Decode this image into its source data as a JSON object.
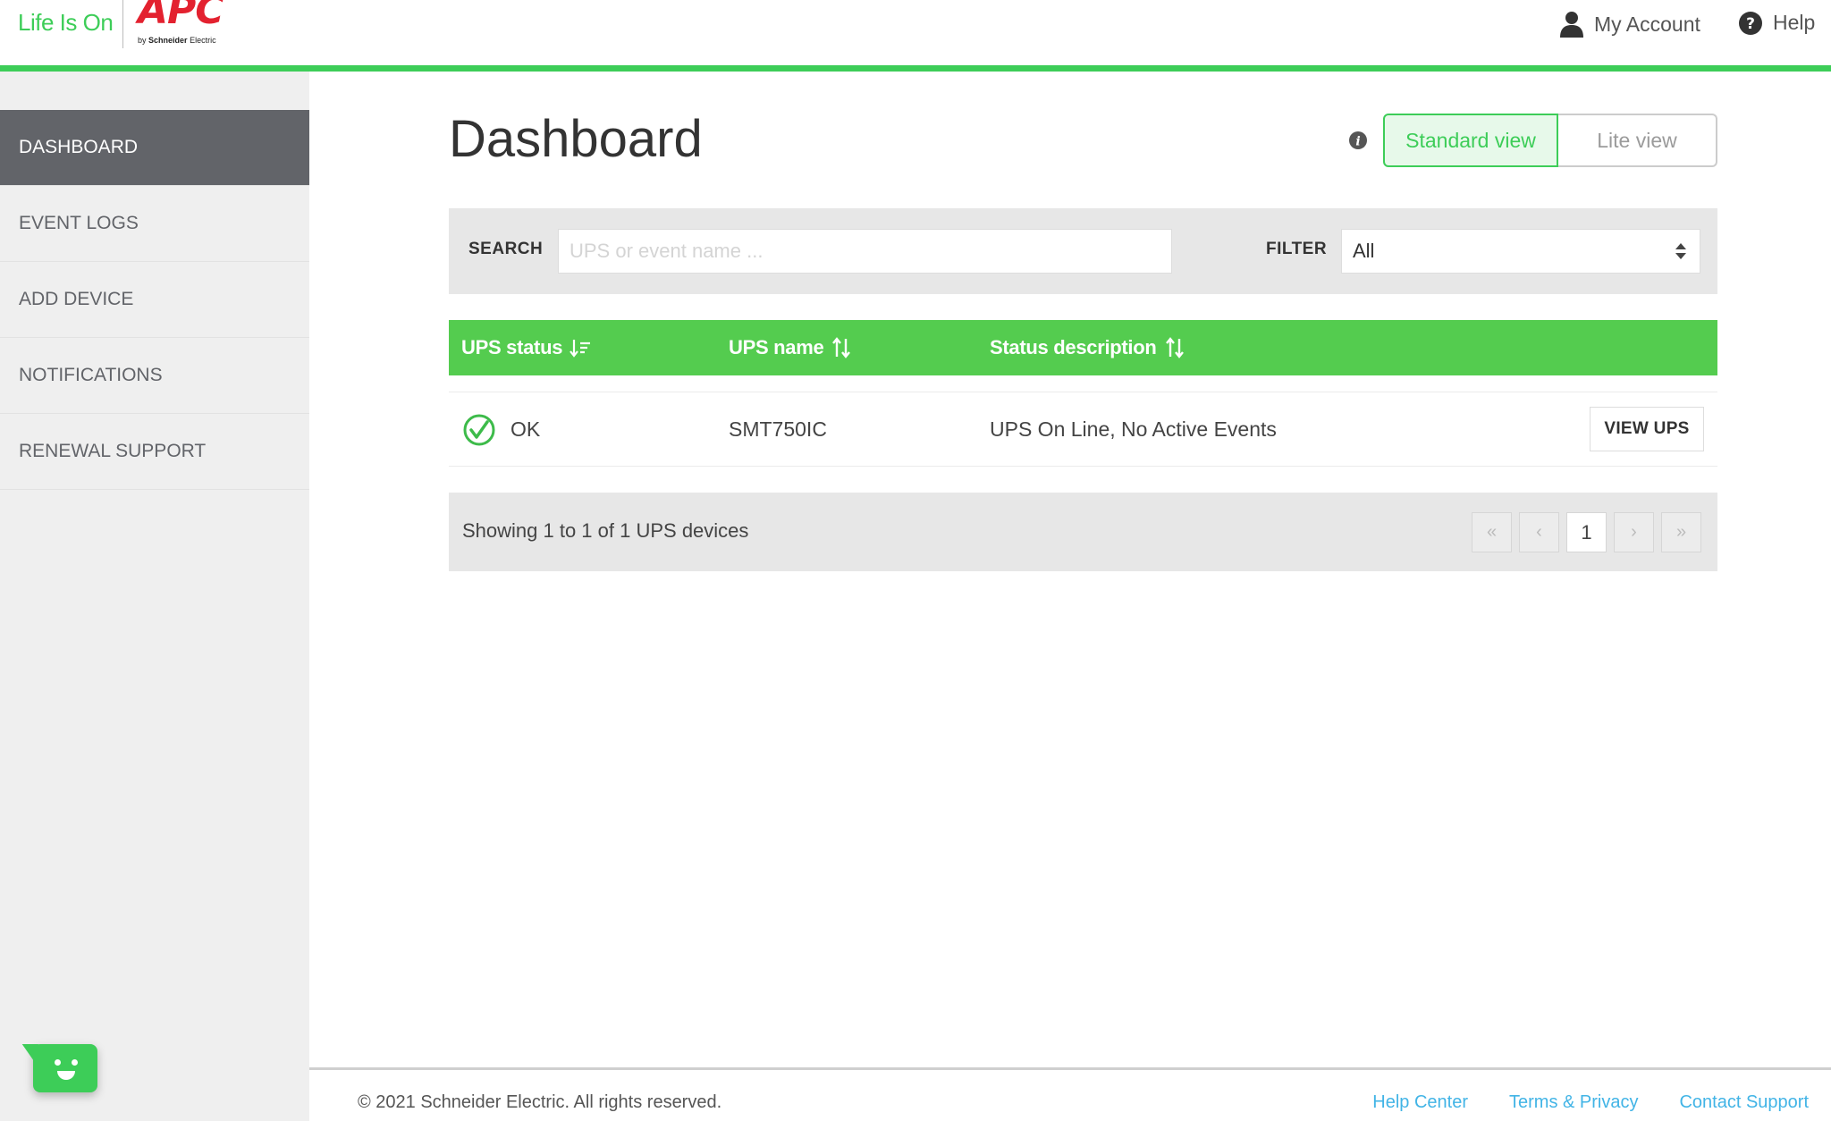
{
  "header": {
    "tagline": "Life Is On",
    "brand": "APC",
    "brand_sub_prefix": "by",
    "brand_sub_company": "Schneider",
    "brand_sub_suffix": "Electric",
    "my_account": "My Account",
    "help": "Help",
    "accent_color": "#3dcd58"
  },
  "sidebar": {
    "items": [
      {
        "label": "DASHBOARD",
        "active": true
      },
      {
        "label": "EVENT LOGS",
        "active": false
      },
      {
        "label": "ADD DEVICE",
        "active": false
      },
      {
        "label": "NOTIFICATIONS",
        "active": false
      },
      {
        "label": "RENEWAL SUPPORT",
        "active": false
      }
    ]
  },
  "main": {
    "title": "Dashboard",
    "views": {
      "standard": "Standard view",
      "lite": "Lite view",
      "selected": "standard"
    },
    "search": {
      "label": "SEARCH",
      "placeholder": "UPS or event name ...",
      "value": ""
    },
    "filter": {
      "label": "FILTER",
      "selected": "All"
    },
    "table": {
      "columns": [
        "UPS status",
        "UPS name",
        "Status description"
      ],
      "rows": [
        {
          "status": "OK",
          "name": "SMT750IC",
          "description": "UPS On Line, No Active Events",
          "action": "VIEW UPS"
        }
      ]
    },
    "pagination": {
      "summary": "Showing 1 to 1 of 1 UPS devices",
      "first": "«",
      "prev": "‹",
      "current_page": "1",
      "next": "›",
      "last": "»"
    }
  },
  "footer": {
    "copyright": "© 2021 Schneider Electric. All rights reserved.",
    "links": [
      "Help Center",
      "Terms & Privacy",
      "Contact Support"
    ]
  },
  "icons": {
    "account": "user-icon",
    "help": "question-circle-icon",
    "info": "info-circle-icon",
    "status_ok": "check-circle-icon",
    "chat": "chat-bot-icon"
  }
}
